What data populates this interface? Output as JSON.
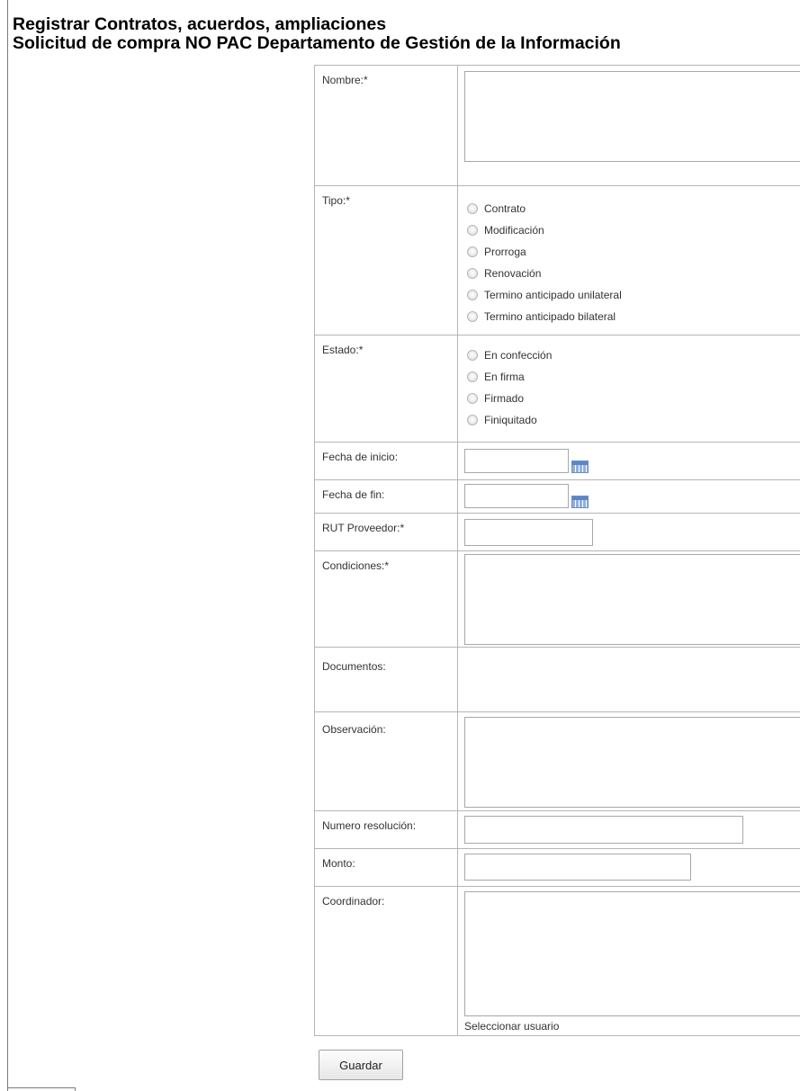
{
  "page": {
    "title_line1": "Registrar Contratos, acuerdos, ampliaciones",
    "title_line2": "Solicitud de compra NO PAC Departamento de Gestión de la Información"
  },
  "form": {
    "nombre_label": "Nombre:*",
    "nombre_value": "",
    "tipo_label": "Tipo:*",
    "tipo_options": [
      "Contrato",
      "Modificación",
      "Prorroga",
      "Renovación",
      "Termino anticipado unilateral",
      "Termino anticipado bilateral"
    ],
    "estado_label": "Estado:*",
    "estado_options": [
      "En confección",
      "En firma",
      "Firmado",
      "Finiquitado"
    ],
    "fecha_inicio_label": "Fecha de inicio:",
    "fecha_inicio_value": "",
    "fecha_fin_label": "Fecha de fin:",
    "fecha_fin_value": "",
    "rut_label": "RUT Proveedor:*",
    "rut_value": "",
    "condiciones_label": "Condiciones:*",
    "condiciones_value": "",
    "documentos_label": "Documentos:",
    "observacion_label": "Observación:",
    "observacion_value": "",
    "numero_resolucion_label": "Numero resolución:",
    "numero_resolucion_value": "",
    "monto_label": "Monto:",
    "monto_value": "",
    "coordinador_label": "Coordinador:",
    "coordinador_value": "",
    "seleccionar_usuario": "Seleccionar usuario",
    "calendar_icon": "calendar-icon"
  },
  "actions": {
    "save_label": "Guardar"
  },
  "colors": {
    "border": "#b5b5b5",
    "calendar_blue": "#5b86c6"
  }
}
